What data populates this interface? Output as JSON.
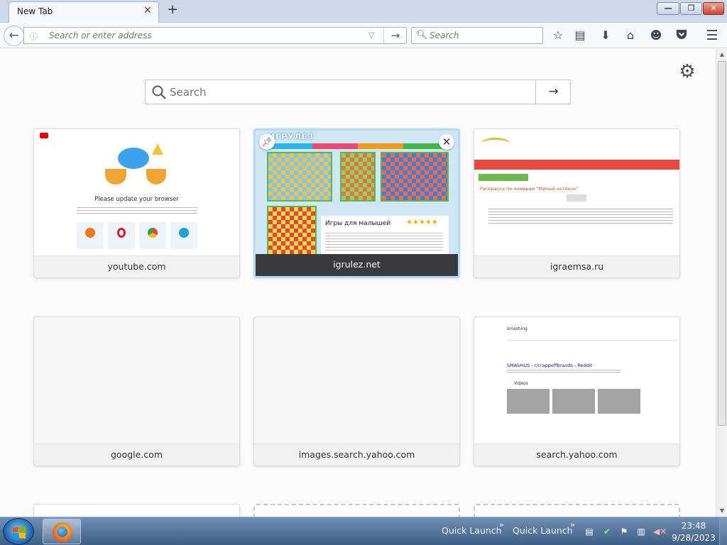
{
  "browser": {
    "tab": {
      "title": "New Tab",
      "close": "✕"
    },
    "new_tab_symbol": "+",
    "window_controls": {
      "minimize": "—",
      "maximize": "❐",
      "close": "✕"
    },
    "url_bar": {
      "placeholder": "Search or enter address",
      "go": "→"
    },
    "search_bar": {
      "placeholder": "Search"
    },
    "toolbar_icons": [
      "bookmark-star-icon",
      "reading-list-icon",
      "download-icon",
      "home-icon",
      "hello-icon",
      "pocket-icon",
      "menu-icon"
    ]
  },
  "newtab": {
    "search": {
      "placeholder": "Search",
      "go": "→"
    },
    "tiles": [
      {
        "title": "youtube.com",
        "preview": {
          "heading": "Please update your browser",
          "browsers": [
            "Mozilla Firefox",
            "Opera",
            "Google Chrome",
            "Microsoft Edge"
          ]
        }
      },
      {
        "title": "igrulez.net",
        "hovered": true,
        "preview": {
          "logo": "ИГРУЛЕЗ",
          "heading": "Игры для малышей"
        }
      },
      {
        "title": "igraemsa.ru",
        "preview": {
          "heading": "Раскраска по номерам \"Милый котёнок\""
        }
      },
      {
        "title": "google.com"
      },
      {
        "title": "images.search.yahoo.com"
      },
      {
        "title": "search.yahoo.com",
        "preview": {
          "query": "smashing",
          "result": "SMASHUS - r/crappoffbrands - Reddit",
          "section": "Videos"
        }
      }
    ]
  },
  "taskbar": {
    "quick_launch": [
      "Quick Launch",
      "Quick Launch"
    ],
    "clock": {
      "time": "23:48",
      "date": "9/28/2023"
    }
  },
  "colors": {
    "accent": "#0a84ff",
    "hover_border": "#b5dcf7",
    "taskbar": "#3d5e86"
  }
}
